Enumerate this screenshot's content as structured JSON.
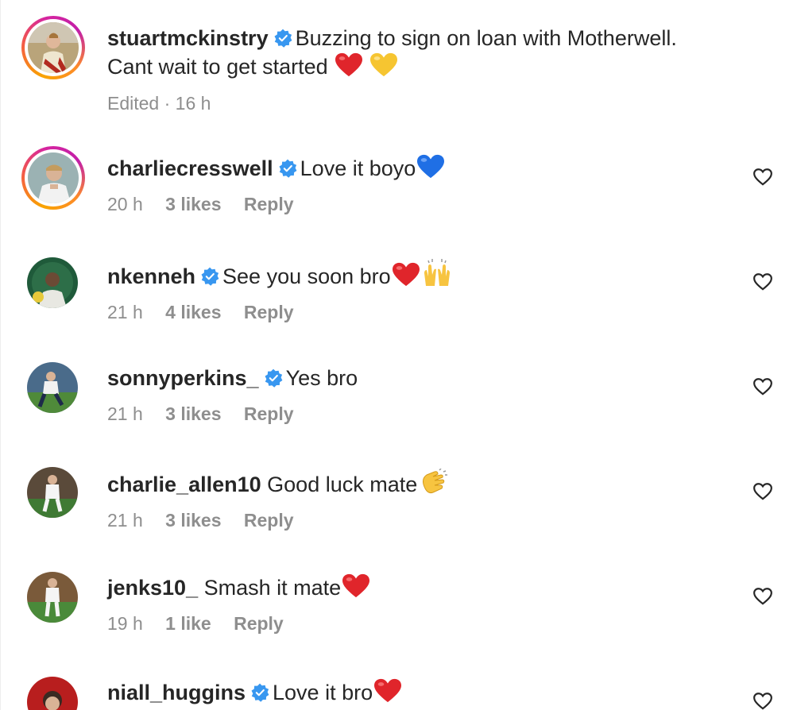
{
  "caption": {
    "username": "stuartmckinstry",
    "text_line1": "Buzzing to sign on loan with Motherwell.",
    "text_line2": "Cant wait to get started",
    "edited_label": "Edited",
    "separator": "·",
    "time": "16 h",
    "avatar_icon": "player-avatar-icon"
  },
  "comments": [
    {
      "username": "charliecresswell",
      "verified": true,
      "text": "Love it boyo",
      "emoji": "blue-heart",
      "time": "20 h",
      "likes": "3 likes",
      "reply": "Reply"
    },
    {
      "username": "nkenneh",
      "verified": true,
      "text": "See you soon bro",
      "emoji": "red-heart raising-hands",
      "time": "21 h",
      "likes": "4 likes",
      "reply": "Reply"
    },
    {
      "username": "sonnyperkins_",
      "verified": true,
      "text": "Yes bro",
      "emoji": "",
      "time": "21 h",
      "likes": "3 likes",
      "reply": "Reply"
    },
    {
      "username": "charlie_allen10",
      "verified": false,
      "text": "Good luck mate",
      "emoji": "clapping-hands",
      "time": "21 h",
      "likes": "3 likes",
      "reply": "Reply"
    },
    {
      "username": "jenks10_",
      "verified": false,
      "text": "Smash it mate",
      "emoji": "red-heart",
      "time": "19 h",
      "likes": "1 like",
      "reply": "Reply"
    },
    {
      "username": "niall_huggins",
      "verified": true,
      "text": "Love it bro",
      "emoji": "red-heart",
      "time": "",
      "likes": "",
      "reply": ""
    }
  ],
  "colors": {
    "text": "#262626",
    "muted": "#8e8e8e",
    "verified_blue": "#3897f0",
    "like_icon": "#262626"
  },
  "icons": {
    "verified": "verified-badge-icon",
    "like": "heart-outline-icon"
  }
}
